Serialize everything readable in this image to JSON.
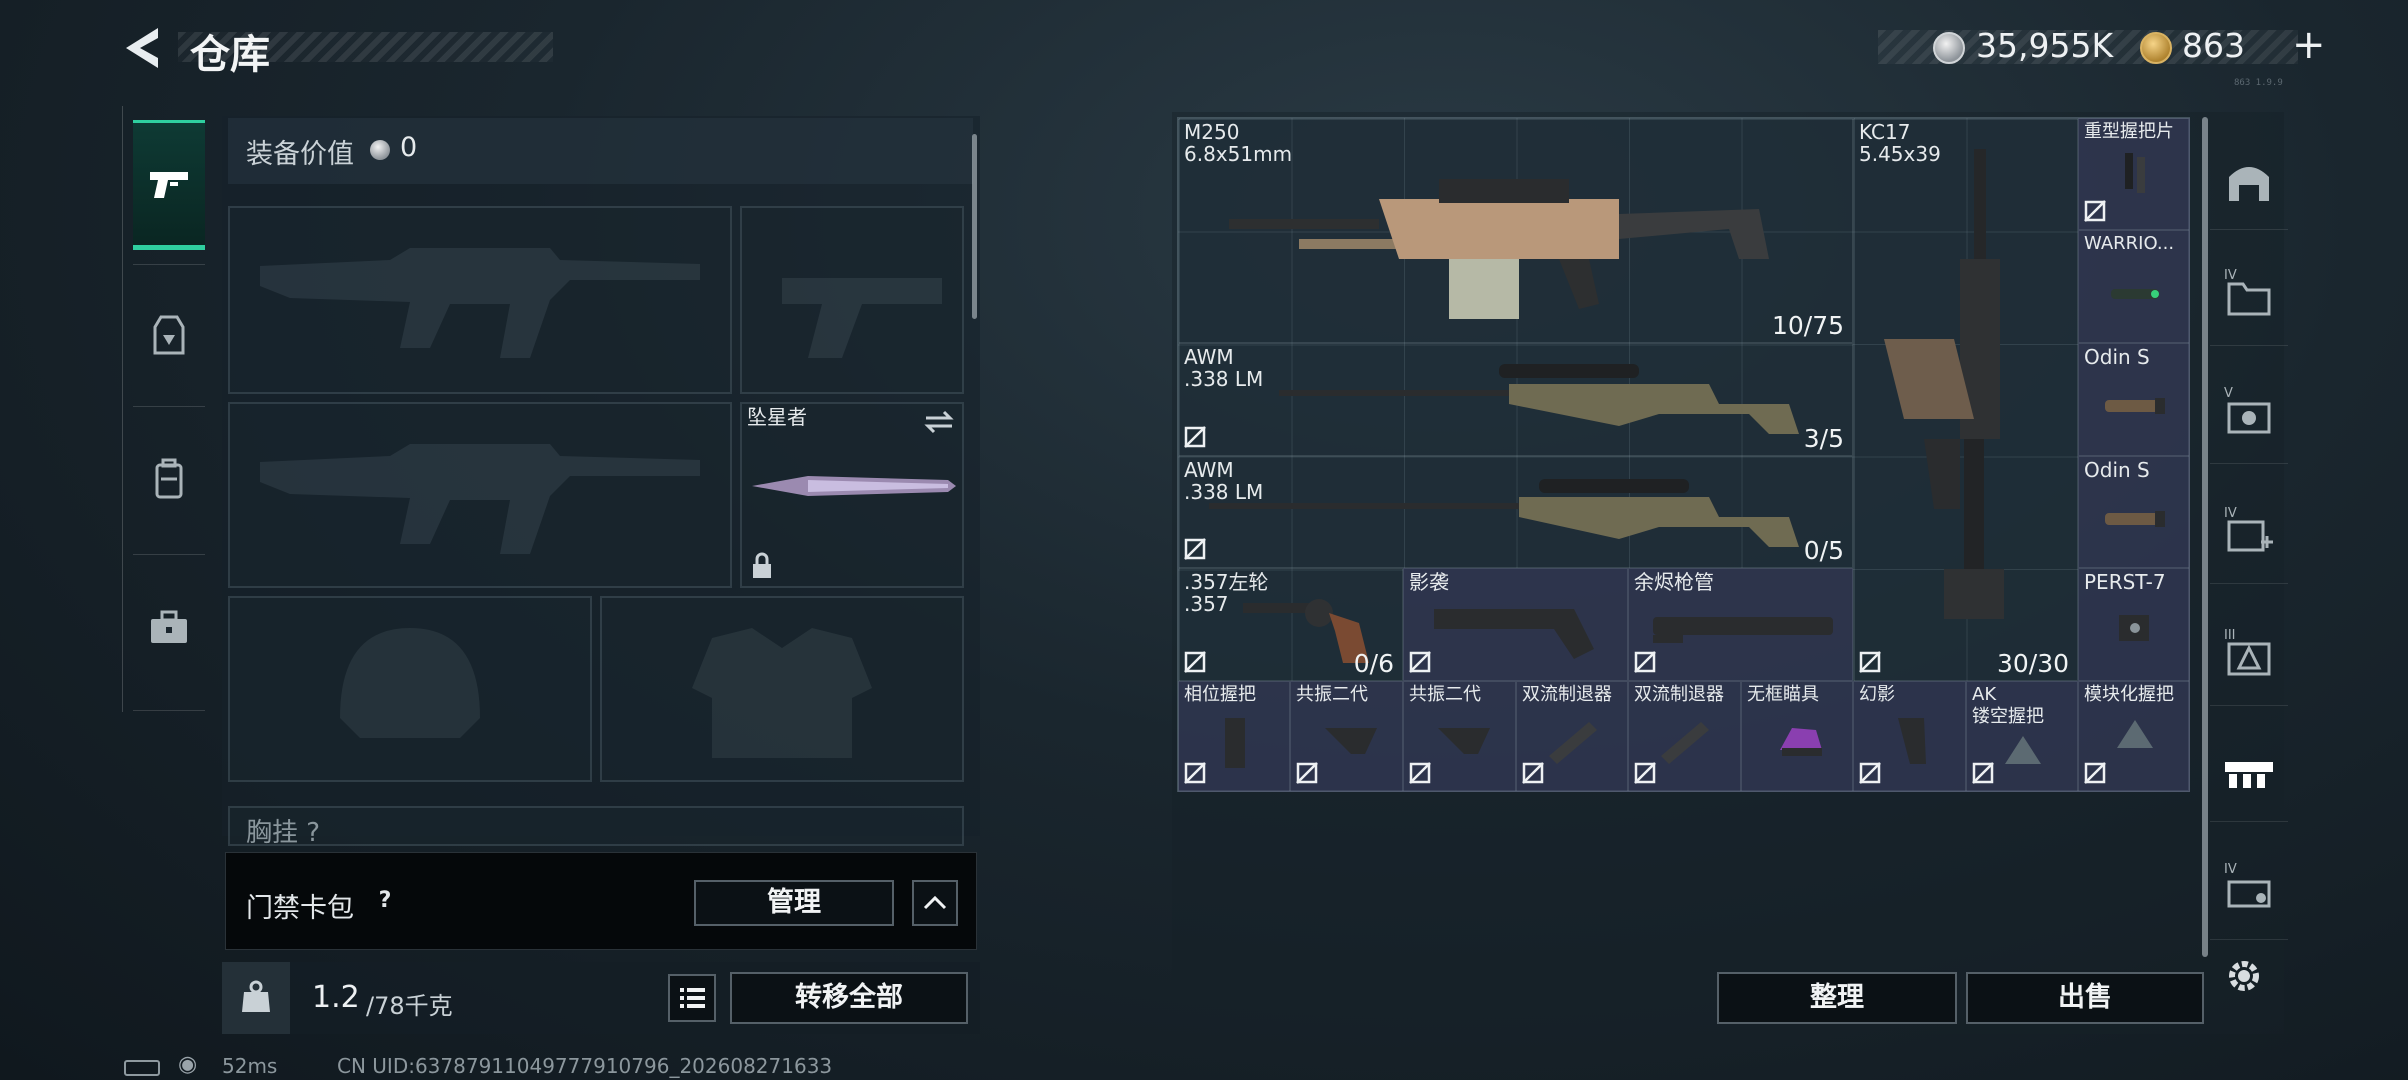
{
  "header": {
    "title": "仓库",
    "back_icon": "back-arrow-icon",
    "currency_money": "35,955K",
    "currency_points": "863",
    "plus_label": "+",
    "version": "863 1.9.9"
  },
  "left_tabs": [
    {
      "icon": "pistol-icon",
      "active": true
    },
    {
      "icon": "armor-vest-icon",
      "active": false
    },
    {
      "icon": "backpack-icon",
      "active": false
    },
    {
      "icon": "briefcase-icon",
      "active": false
    }
  ],
  "loadout": {
    "equip_value_label": "装备价值",
    "equip_value": "0",
    "melee_name": "坠星者",
    "chest_label": "胸挂 ?"
  },
  "card_pack": {
    "label": "门禁卡包",
    "help": "?",
    "manage_label": "管理"
  },
  "weight": {
    "current": "1.2",
    "max": "/78千克",
    "transfer_label": "转移全部"
  },
  "status": {
    "ping": "52ms",
    "uid": "CN UID:637879110497779107​96_202608271633"
  },
  "stash": {
    "items": [
      {
        "name": "M250\n6.8x51mm",
        "count": "10/75"
      },
      {
        "name": "KC17\n5.45x39",
        "count": "30/30"
      },
      {
        "name": "重型握把片",
        "count": ""
      },
      {
        "name": "WARRIO...",
        "count": ""
      },
      {
        "name": "AWM\n.338 LM",
        "count": "3/5"
      },
      {
        "name": "Odin S",
        "count": ""
      },
      {
        "name": "AWM\n.338 LM",
        "count": "0/5"
      },
      {
        "name": "Odin S",
        "count": ""
      },
      {
        "name": ".357左轮\n.357",
        "count": "0/6"
      },
      {
        "name": "影袭",
        "count": ""
      },
      {
        "name": "余烬枪管",
        "count": ""
      },
      {
        "name": "PERST-7",
        "count": ""
      },
      {
        "name": "相位握把",
        "count": ""
      },
      {
        "name": "共振二代",
        "count": ""
      },
      {
        "name": "共振二代",
        "count": ""
      },
      {
        "name": "双流制退器",
        "count": ""
      },
      {
        "name": "双流制退器",
        "count": ""
      },
      {
        "name": "无框瞄具",
        "count": ""
      },
      {
        "name": "幻影",
        "count": ""
      },
      {
        "name": "AK\n镂空握把",
        "count": ""
      },
      {
        "name": "模块化握把",
        "count": ""
      }
    ],
    "sort_label": "整理",
    "sell_label": "出售"
  },
  "right_tabs": [
    {
      "icon": "stash-home-icon",
      "level": ""
    },
    {
      "icon": "folder-tab-icon",
      "level": "IV"
    },
    {
      "icon": "camera-tab-icon",
      "level": "V"
    },
    {
      "icon": "medical-tab-icon",
      "level": "IV"
    },
    {
      "icon": "warning-tab-icon",
      "level": "III"
    },
    {
      "icon": "attachments-tab-icon",
      "level": ""
    },
    {
      "icon": "crate-tab-icon",
      "level": "IV"
    }
  ],
  "colors": {
    "accent_green": "#2fcf9f",
    "purple_rarity": "#3c3e60",
    "panel_dark": "#0b1115"
  }
}
